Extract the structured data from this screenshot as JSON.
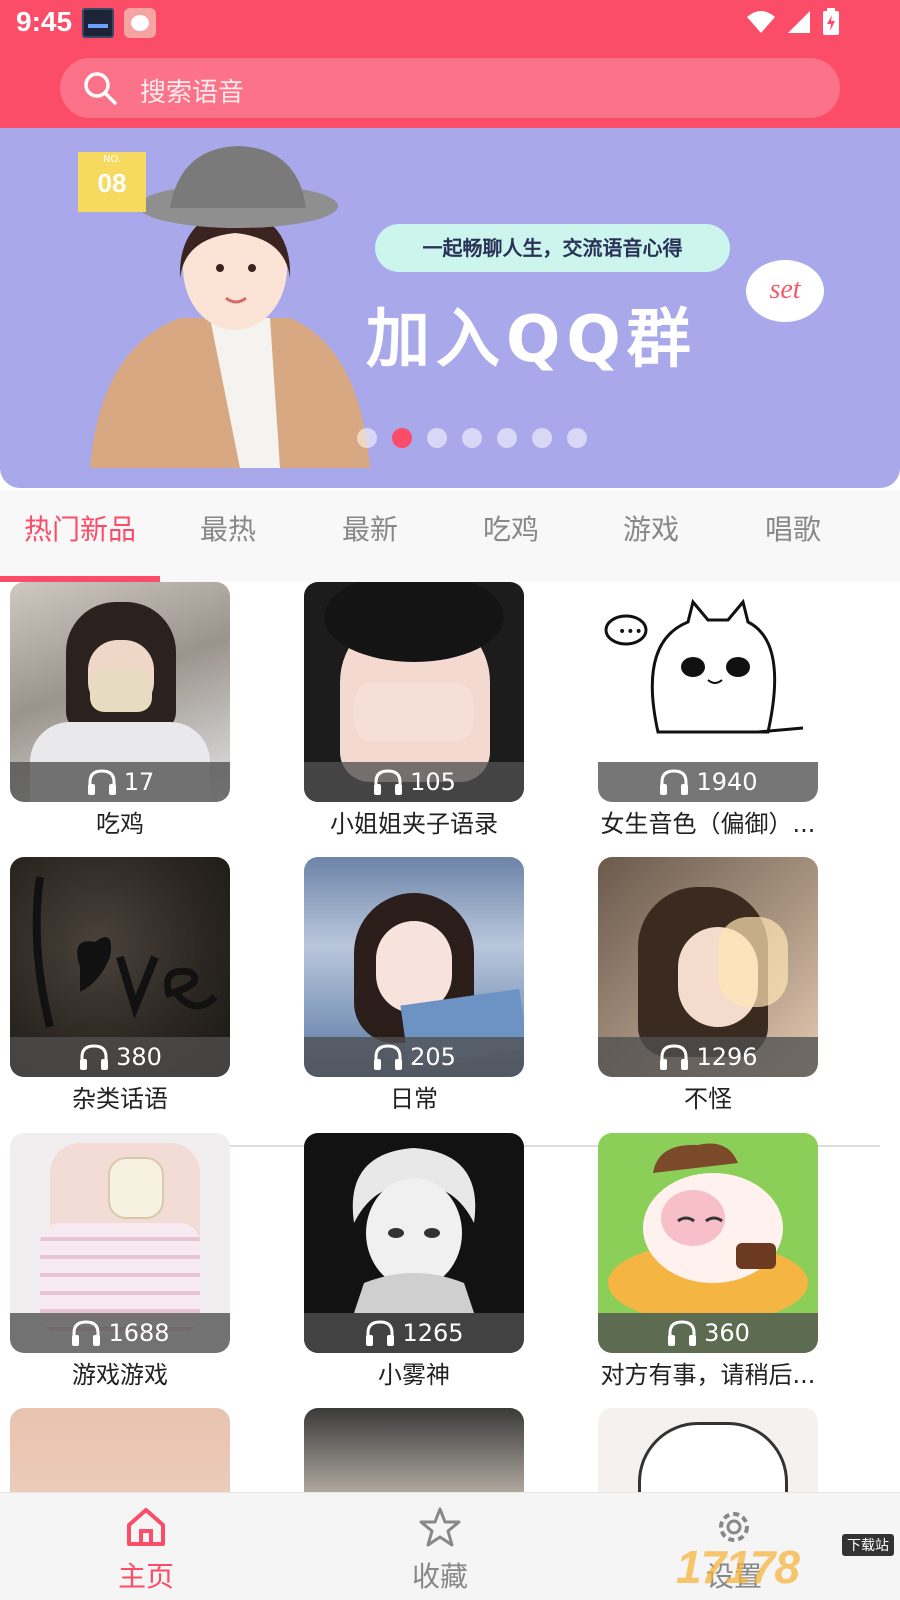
{
  "status_bar": {
    "time": "9:45"
  },
  "search": {
    "placeholder": "搜索语音"
  },
  "banner": {
    "badge_no": "NO.",
    "badge_num": "08",
    "tagline": "一起畅聊人生，交流语音心得",
    "headline": "加入QQ群",
    "sticker": "set",
    "dot_count": 7,
    "active_dot": 2
  },
  "tabs": [
    {
      "label": "热门新品",
      "active": true
    },
    {
      "label": "最热",
      "active": false
    },
    {
      "label": "最新",
      "active": false
    },
    {
      "label": "吃鸡",
      "active": false
    },
    {
      "label": "游戏",
      "active": false
    },
    {
      "label": "唱歌",
      "active": false
    }
  ],
  "cards": [
    {
      "title": "吃鸡",
      "count": "17"
    },
    {
      "title": "小姐姐夹子语录",
      "count": "105"
    },
    {
      "title": "女生音色（偏御）...",
      "count": "1940"
    },
    {
      "title": "杂类话语",
      "count": "380"
    },
    {
      "title": "日常",
      "count": "205"
    },
    {
      "title": "不怪",
      "count": "1296"
    },
    {
      "title": "游戏游戏",
      "count": "1688"
    },
    {
      "title": "小雾神",
      "count": "1265"
    },
    {
      "title": "对方有事，请稍后...",
      "count": "360"
    }
  ],
  "bottom_nav": [
    {
      "label": "主页",
      "icon": "home-icon",
      "active": true
    },
    {
      "label": "收藏",
      "icon": "star-icon",
      "active": false
    },
    {
      "label": "设置",
      "icon": "gear-icon",
      "active": false
    }
  ],
  "watermark": {
    "text": "17178",
    "tag": "下载站"
  },
  "colors": {
    "accent": "#fb4c68",
    "banner_bg": "#a8a8eb",
    "tab_bg": "#f8f8f8"
  }
}
